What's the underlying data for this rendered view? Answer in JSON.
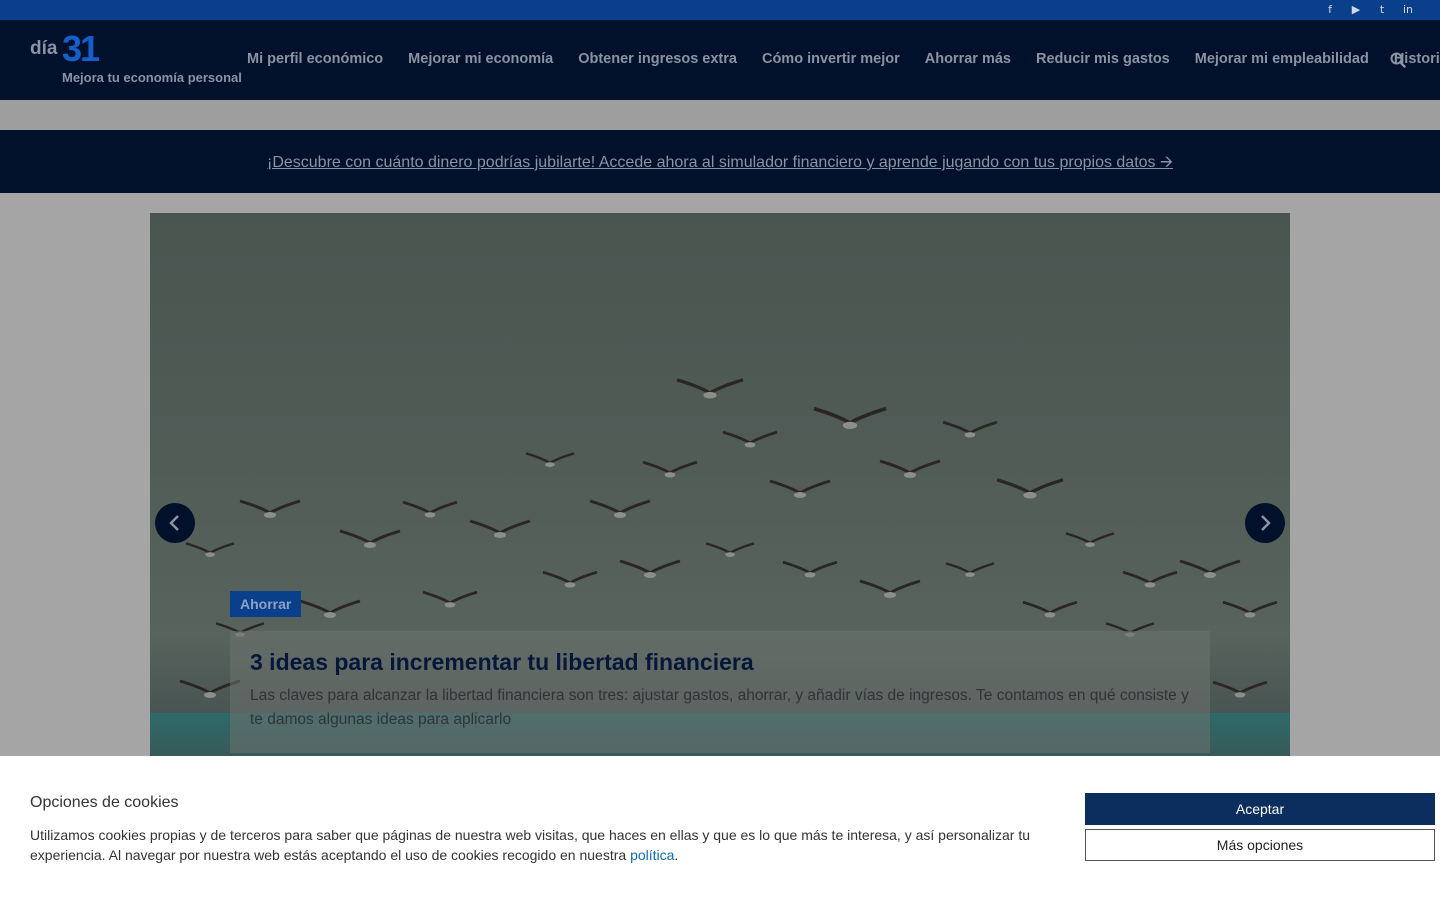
{
  "social": {
    "icons": [
      "facebook-icon",
      "youtube-icon",
      "twitter-icon",
      "linkedin-icon"
    ],
    "glyphs": {
      "facebook": "f",
      "youtube": "▶",
      "twitter": "t",
      "linkedin": "in"
    }
  },
  "brand": {
    "logo_prefix": "día",
    "logo_number": "31",
    "tagline": "Mejora tu economía personal"
  },
  "nav": {
    "items": [
      "Mi perfil económico",
      "Mejorar mi economía",
      "Obtener ingresos extra",
      "Cómo invertir mejor",
      "Ahorrar más",
      "Reducir mis gastos",
      "Mejorar mi empleabilidad",
      "Historias"
    ]
  },
  "promo": {
    "text": "¡Descubre con cuánto dinero podrías jubilarte! Accede ahora al simulador financiero y aprende jugando con tus propios datos 🡪"
  },
  "slider": {
    "category": "Ahorrar",
    "title": "3 ideas para incrementar tu libertad financiera",
    "excerpt": "Las claves para alcanzar la libertad financiera son tres: ajustar gastos, ahorrar, y añadir vías de ingresos. Te contamos en qué consiste y te damos algunas ideas para aplicarlo"
  },
  "cookies": {
    "title": "Opciones de cookies",
    "text_before_link": "Utilizamos cookies propias y de terceros para saber que páginas de nuestra web visitas, que haces en ellas y que es lo que más te interesa, y así personalizar tu experiencia. Al navegar por nuestra web estás aceptando el uso de cookies recogido en nuestra ",
    "link_text": "política",
    "text_after_link": ".",
    "accept_label": "Aceptar",
    "more_label": "Más opciones"
  },
  "colors": {
    "top_bar": "#0a3f8c",
    "header_bg": "#01102b",
    "accent_blue": "#155ecf",
    "accept_button": "#0b2e5e"
  }
}
